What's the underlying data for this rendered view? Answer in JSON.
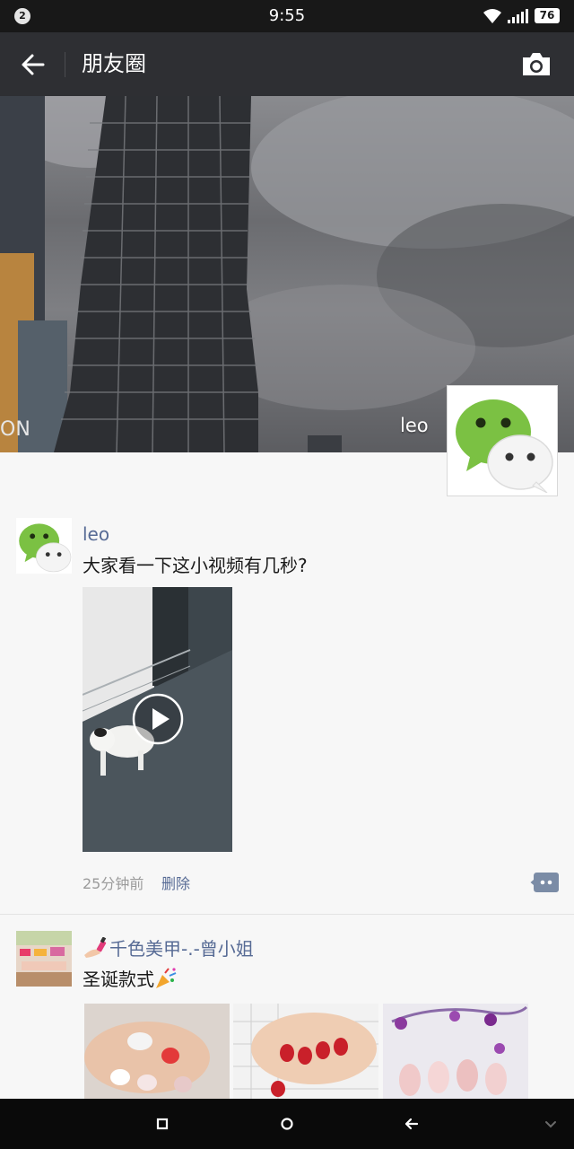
{
  "status": {
    "notification_count": "2",
    "time": "9:55",
    "battery": "76",
    "icons": [
      "wifi-icon",
      "signal-icon",
      "battery-icon"
    ]
  },
  "nav": {
    "title": "朋友圈",
    "back_icon": "back-arrow-icon",
    "camera_icon": "camera-icon"
  },
  "cover": {
    "username": "leo"
  },
  "posts": [
    {
      "username": "leo",
      "text": "大家看一下这小视频有几秒?",
      "media": "video",
      "time": "25分钟前",
      "delete_label": "删除"
    },
    {
      "username": "千色美甲-.-曾小姐",
      "text": "圣诞款式",
      "media": "photos"
    }
  ],
  "colors": {
    "link": "#576b95",
    "nav_bg": "#2e2f33",
    "wechat_green": "#7bc143"
  }
}
